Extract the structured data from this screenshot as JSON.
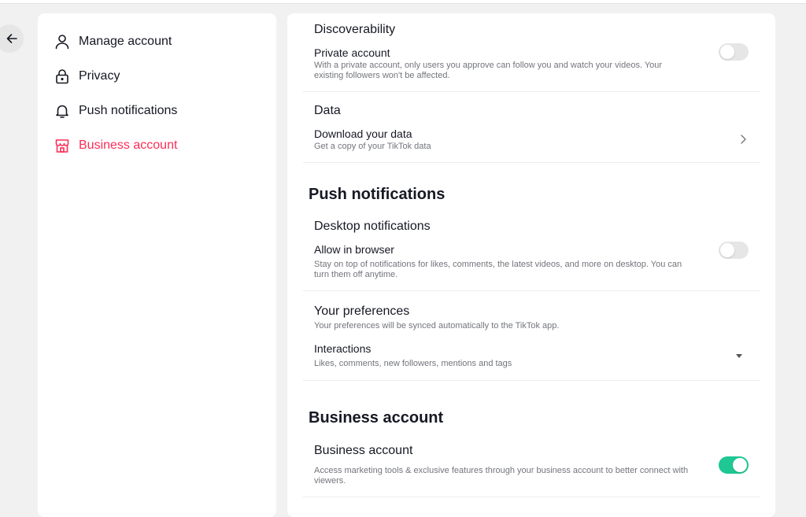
{
  "sidebar": {
    "items": [
      {
        "label": "Manage account",
        "icon": "person-icon"
      },
      {
        "label": "Privacy",
        "icon": "lock-icon"
      },
      {
        "label": "Push notifications",
        "icon": "bell-icon"
      },
      {
        "label": "Business account",
        "icon": "shop-icon",
        "active": true
      }
    ]
  },
  "colors": {
    "accent": "#fe2c55",
    "toggle_on": "#1ec794",
    "toggle_off": "#e6e6e7"
  },
  "privacy": {
    "discoverability_heading": "Discoverability",
    "private_account_title": "Private account",
    "private_account_desc": "With a private account, only users you approve can follow you and watch your videos. Your existing followers won't be affected.",
    "private_account_on": false,
    "data_heading": "Data",
    "download_title": "Download your data",
    "download_desc": "Get a copy of your TikTok data"
  },
  "push": {
    "heading": "Push notifications",
    "desktop_heading": "Desktop notifications",
    "allow_title": "Allow in browser",
    "allow_desc": "Stay on top of notifications for likes, comments, the latest videos, and more on desktop. You can turn them off anytime.",
    "allow_on": false,
    "prefs_heading": "Your preferences",
    "prefs_desc": "Your preferences will be synced automatically to the TikTok app.",
    "interactions_title": "Interactions",
    "interactions_desc": "Likes, comments, new followers, mentions and tags"
  },
  "business": {
    "heading": "Business account",
    "title": "Business account",
    "desc": "Access marketing tools & exclusive features through your business account to better connect with viewers.",
    "on": true
  }
}
